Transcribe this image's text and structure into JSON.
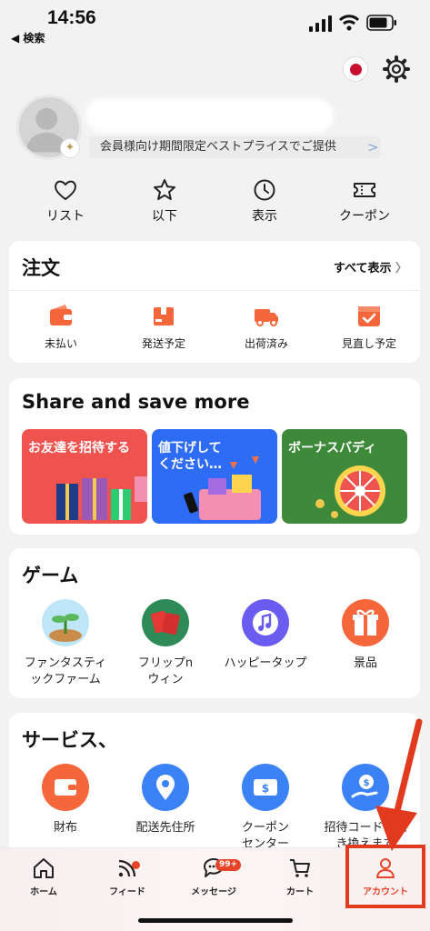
{
  "status": {
    "time": "14:56",
    "back_label": "◀ 検索"
  },
  "profile": {
    "member_text": "会員様向け期間限定ベストプライスでご提供",
    "member_arrow": ">"
  },
  "quick": [
    {
      "label": "リスト",
      "icon": "heart-icon"
    },
    {
      "label": "以下",
      "icon": "star-icon"
    },
    {
      "label": "表示",
      "icon": "clock-icon"
    },
    {
      "label": "クーポン",
      "icon": "ticket-icon"
    }
  ],
  "orders": {
    "title": "注文",
    "see_all": "すべて表示",
    "items": [
      {
        "label": "未払い",
        "icon": "wallet-icon"
      },
      {
        "label": "発送予定",
        "icon": "box-icon"
      },
      {
        "label": "出荷済み",
        "icon": "truck-icon"
      },
      {
        "label": "見直し予定",
        "icon": "review-icon"
      }
    ]
  },
  "share": {
    "title": "Share and save more",
    "promos": [
      {
        "label": "お友達を招待する",
        "color": "#ef5350"
      },
      {
        "label": "値下げして ください…",
        "color": "#2f6cf6"
      },
      {
        "label": "ボーナスバディ",
        "color": "#3f8a3a"
      }
    ]
  },
  "games": {
    "title": "ゲーム",
    "items": [
      {
        "label": "ファンタスティ ックファーム",
        "icon": "farm-icon"
      },
      {
        "label": "フリップn ウィン",
        "icon": "flip-icon"
      },
      {
        "label": "ハッピータップ",
        "icon": "music-icon"
      },
      {
        "label": "景品",
        "icon": "gift-icon"
      }
    ]
  },
  "services": {
    "title": "サービス、",
    "items": [
      {
        "label": "財布",
        "icon": "wallet-icon"
      },
      {
        "label": "配送先住所",
        "icon": "location-icon"
      },
      {
        "label": "クーポン センター",
        "icon": "coupon-icon"
      },
      {
        "label": "招待コードを入 き換えます",
        "icon": "invite-icon"
      }
    ]
  },
  "tabbar": {
    "items": [
      {
        "label": "ホーム"
      },
      {
        "label": "フィード"
      },
      {
        "label": "メッセージ",
        "badge": "99+"
      },
      {
        "label": "カート"
      },
      {
        "label": "アカウント"
      }
    ]
  },
  "colors": {
    "accent": "#e8442a",
    "orange": "#f5663b",
    "blue": "#3b82f6"
  }
}
